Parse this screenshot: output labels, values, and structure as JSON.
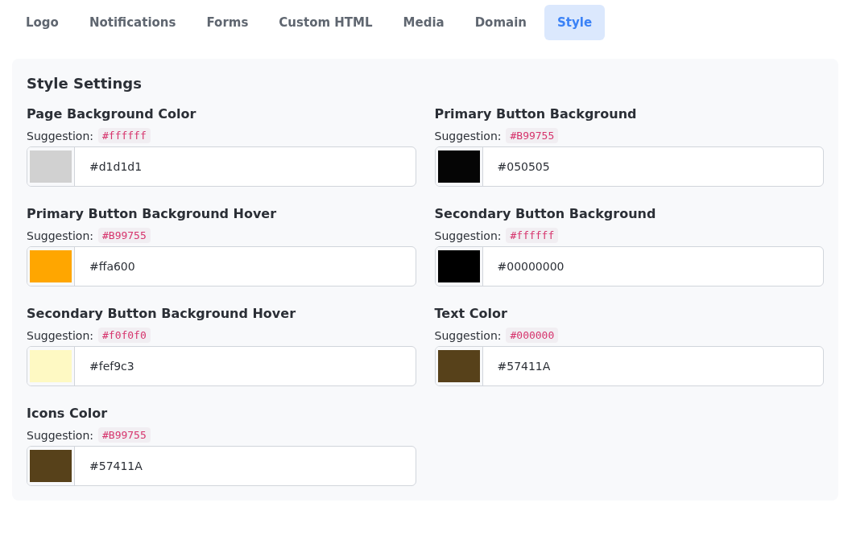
{
  "tabs": [
    {
      "label": "Logo",
      "selected": false
    },
    {
      "label": "Notifications",
      "selected": false
    },
    {
      "label": "Forms",
      "selected": false
    },
    {
      "label": "Custom HTML",
      "selected": false
    },
    {
      "label": "Media",
      "selected": false
    },
    {
      "label": "Domain",
      "selected": false
    },
    {
      "label": "Style",
      "selected": true
    }
  ],
  "panel": {
    "title": "Style Settings",
    "fields": [
      {
        "label": "Page Background Color",
        "suggestion_label": "Suggestion:",
        "suggestion": "#ffffff",
        "value": "#d1d1d1",
        "color": "#d1d1d1"
      },
      {
        "label": "Primary Button Background",
        "suggestion_label": "Suggestion:",
        "suggestion": "#B99755",
        "value": "#050505",
        "color": "#050505"
      },
      {
        "label": "Primary Button Background Hover",
        "suggestion_label": "Suggestion:",
        "suggestion": "#B99755",
        "value": "#ffa600",
        "color": "#ffa600"
      },
      {
        "label": "Secondary Button Background",
        "suggestion_label": "Suggestion:",
        "suggestion": "#ffffff",
        "value": "#00000000",
        "color": "#000000"
      },
      {
        "label": "Secondary Button Background Hover",
        "suggestion_label": "Suggestion:",
        "suggestion": "#f0f0f0",
        "value": "#fef9c3",
        "color": "#fef9c3"
      },
      {
        "label": "Text Color",
        "suggestion_label": "Suggestion:",
        "suggestion": "#000000",
        "value": "#57411A",
        "color": "#57411a"
      },
      {
        "label": "Icons Color",
        "suggestion_label": "Suggestion:",
        "suggestion": "#B99755",
        "value": "#57411A",
        "color": "#57411a"
      }
    ]
  }
}
